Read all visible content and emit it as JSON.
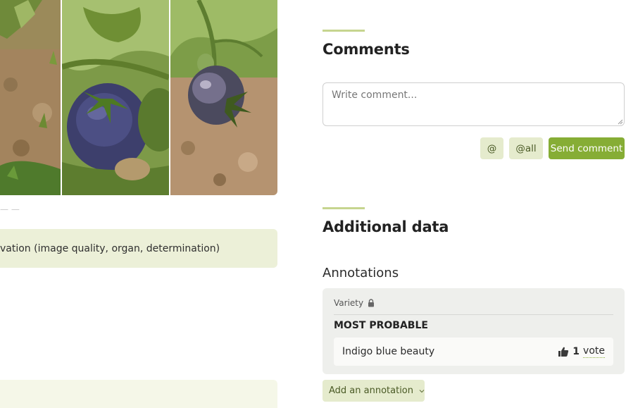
{
  "gallery": {
    "photos": [
      {
        "icon": "soil-crop-photo"
      },
      {
        "icon": "purple-tomato-on-vine-photo"
      },
      {
        "icon": "indigo-tomato-hanging-photo"
      }
    ]
  },
  "left_panel": {
    "evaluation_link": "vation (image quality, organ, determination)"
  },
  "comments": {
    "title": "Comments",
    "placeholder": "Write comment...",
    "mention_label": "@",
    "mention_all_label": "@all",
    "send_label": "Send comment"
  },
  "additional_data": {
    "title": "Additional data",
    "annotations_heading": "Annotations",
    "annotation": {
      "label": "Variety",
      "lock_icon": "lock-icon",
      "group_heading": "MOST PROBABLE",
      "value": "Indigo blue beauty",
      "vote_icon": "thumbs-up-icon",
      "vote_count": "1",
      "vote_word": "vote"
    },
    "add_annotation_label": "Add an annotation"
  },
  "colors": {
    "accent_green": "#86ad35",
    "soft_green": "#e5ebcd",
    "eval_bar": "#ecf0d8",
    "section_rule": "#c6d58f"
  }
}
